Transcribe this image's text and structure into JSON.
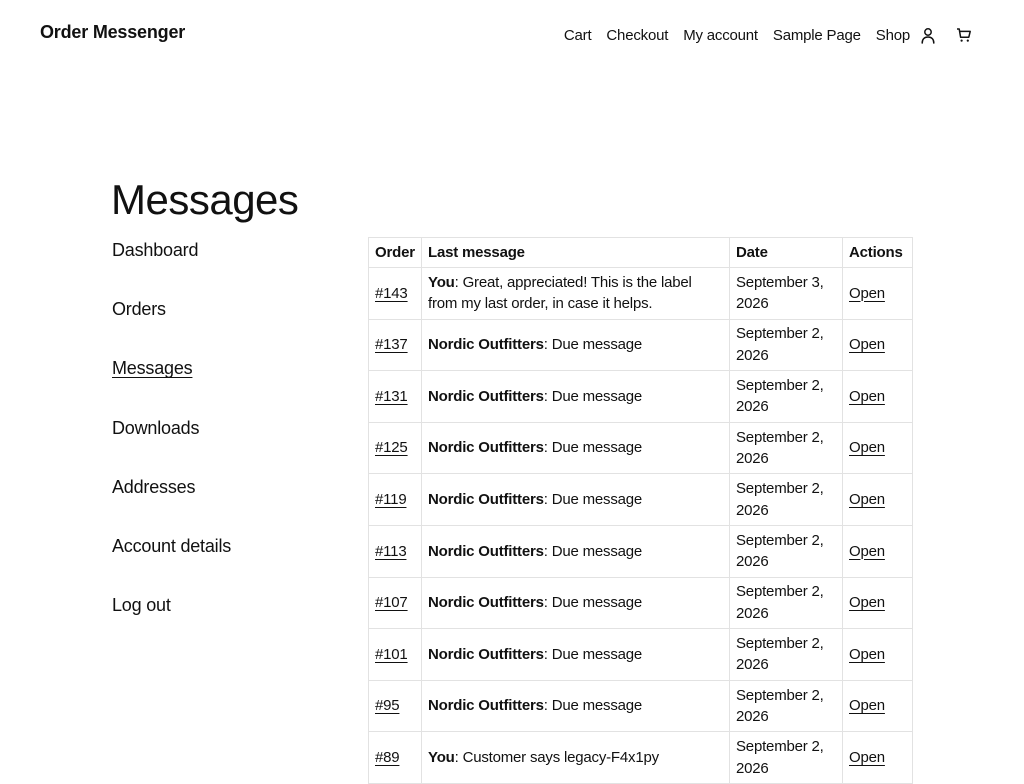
{
  "site": {
    "title": "Order Messenger"
  },
  "nav": {
    "items": [
      "Cart",
      "Checkout",
      "My account",
      "Sample Page",
      "Shop"
    ],
    "icons": {
      "account": "user-icon",
      "cart": "cart-icon"
    }
  },
  "page": {
    "title": "Messages"
  },
  "account_nav": {
    "items": [
      "Dashboard",
      "Orders",
      "Messages",
      "Downloads",
      "Addresses",
      "Account details",
      "Log out"
    ],
    "active": "Messages"
  },
  "table": {
    "headers": [
      "Order",
      "Last message",
      "Date",
      "Actions"
    ],
    "rows": [
      {
        "order": "#143",
        "sender": "You",
        "message": "Great, appreciated! This is the label from my last order, in case it helps.",
        "date": "September 3, 2026",
        "action": "Open"
      },
      {
        "order": "#137",
        "sender": "Nordic Outfitters",
        "message": "Due message",
        "date": "September 2, 2026",
        "action": "Open"
      },
      {
        "order": "#131",
        "sender": "Nordic Outfitters",
        "message": "Due message",
        "date": "September 2, 2026",
        "action": "Open"
      },
      {
        "order": "#125",
        "sender": "Nordic Outfitters",
        "message": "Due message",
        "date": "September 2, 2026",
        "action": "Open"
      },
      {
        "order": "#119",
        "sender": "Nordic Outfitters",
        "message": "Due message",
        "date": "September 2, 2026",
        "action": "Open"
      },
      {
        "order": "#113",
        "sender": "Nordic Outfitters",
        "message": "Due message",
        "date": "September 2, 2026",
        "action": "Open"
      },
      {
        "order": "#107",
        "sender": "Nordic Outfitters",
        "message": "Due message",
        "date": "September 2, 2026",
        "action": "Open"
      },
      {
        "order": "#101",
        "sender": "Nordic Outfitters",
        "message": "Due message",
        "date": "September 2, 2026",
        "action": "Open"
      },
      {
        "order": "#95",
        "sender": "Nordic Outfitters",
        "message": "Due message",
        "date": "September 2, 2026",
        "action": "Open"
      },
      {
        "order": "#89",
        "sender": "You",
        "message": "Customer says legacy-F4x1py",
        "date": "September 2, 2026",
        "action": "Open"
      }
    ]
  }
}
